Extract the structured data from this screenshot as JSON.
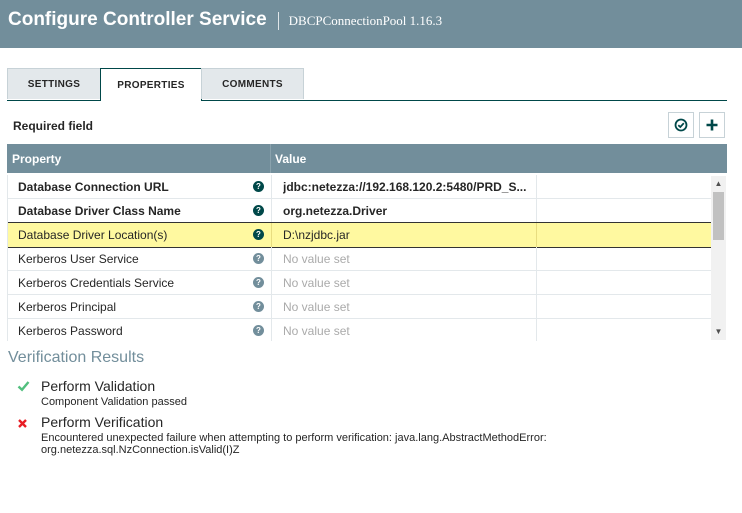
{
  "header": {
    "title": "Configure Controller Service",
    "subtitle": "DBCPConnectionPool 1.16.3"
  },
  "tabs": [
    {
      "label": "SETTINGS",
      "active": false
    },
    {
      "label": "PROPERTIES",
      "active": true
    },
    {
      "label": "COMMENTS",
      "active": false
    }
  ],
  "required_field_label": "Required field",
  "toolbar": {
    "verify_icon": "check-circle-icon",
    "add_icon": "plus-icon"
  },
  "table": {
    "headers": {
      "property": "Property",
      "value": "Value"
    },
    "rows": [
      {
        "name": "Database Connection URL",
        "value": "jdbc:netezza://192.168.120.2:5480/PRD_S...",
        "required": true,
        "set": true
      },
      {
        "name": "Database Driver Class Name",
        "value": "org.netezza.Driver",
        "required": true,
        "set": true
      },
      {
        "name": "Database Driver Location(s)",
        "value": "D:\\nzjdbc.jar",
        "required": false,
        "set": true,
        "selected": true
      },
      {
        "name": "Kerberos User Service",
        "value": "No value set",
        "required": false,
        "set": false
      },
      {
        "name": "Kerberos Credentials Service",
        "value": "No value set",
        "required": false,
        "set": false
      },
      {
        "name": "Kerberos Principal",
        "value": "No value set",
        "required": false,
        "set": false
      },
      {
        "name": "Kerberos Password",
        "value": "No value set",
        "required": false,
        "set": false
      }
    ]
  },
  "verification": {
    "title": "Verification Results",
    "results": [
      {
        "status": "pass",
        "title": "Perform Validation",
        "text": "Component Validation passed"
      },
      {
        "status": "fail",
        "title": "Perform Verification",
        "text_line1": "Encountered unexpected failure when attempting to perform verification: java.lang.AbstractMethodError:",
        "text_line2": "org.netezza.sql.NzConnection.isValid(I)Z"
      }
    ]
  },
  "colors": {
    "header": "#728e9b",
    "selected_row": "#fff9a0",
    "pass": "#52bf7e",
    "fail": "#e81e25",
    "accent": "#004849"
  }
}
